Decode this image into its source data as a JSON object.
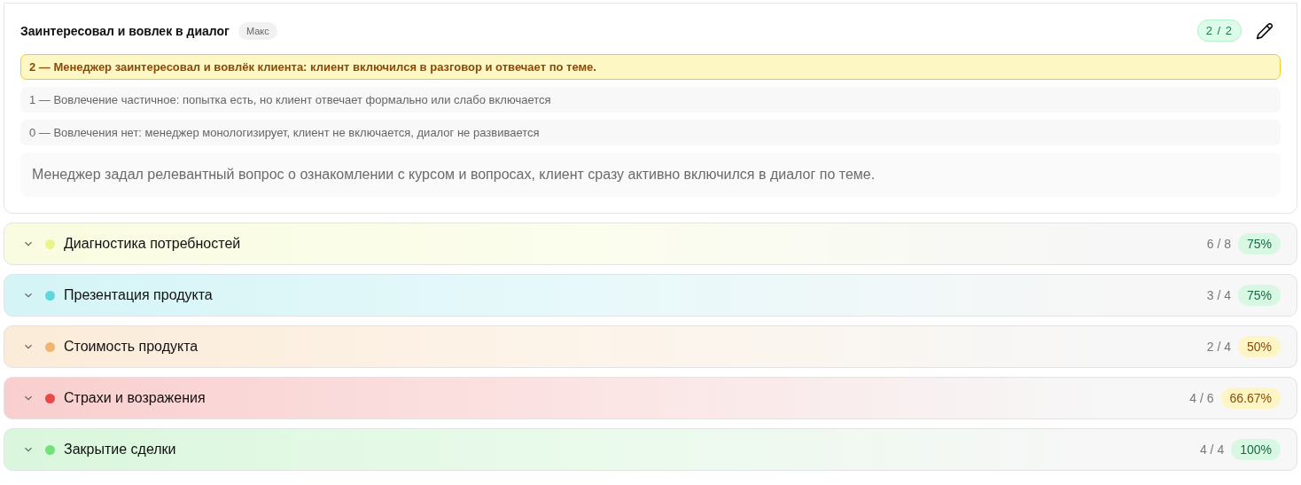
{
  "criterion": {
    "title": "Заинтересовал и вовлек в диалог",
    "tag": "Макс",
    "score": "2 / 2",
    "options": [
      {
        "text": "2 — Менеджер заинтересовал и вовлёк клиента: клиент включился в разговор и отвечает по теме.",
        "selected": true
      },
      {
        "text": "1 — Вовлечение частичное: попытка есть, но клиент отвечает формально или слабо включается",
        "selected": false
      },
      {
        "text": "0 — Вовлечения нет: менеджер монологизирует, клиент не включается, диалог не развивается",
        "selected": false
      }
    ],
    "comment": "Менеджер задал релевантный вопрос о ознакомлении с курсом и вопросах, клиент сразу активно включился в диалог по теме."
  },
  "sections": [
    {
      "title": "Диагностика потребностей",
      "color": "#e9f58a",
      "score": "6 / 8",
      "percent": "75%",
      "kind": "good",
      "expanded": false
    },
    {
      "title": "Презентация продукта",
      "color": "#5fd6de",
      "score": "3 / 4",
      "percent": "75%",
      "kind": "good",
      "expanded": false
    },
    {
      "title": "Стоимость продукта",
      "color": "#f0b570",
      "score": "2 / 4",
      "percent": "50%",
      "kind": "warn",
      "expanded": false
    },
    {
      "title": "Страхи и возражения",
      "color": "#e84848",
      "score": "4 / 6",
      "percent": "66.67%",
      "kind": "warn",
      "expanded": false
    },
    {
      "title": "Закрытие сделки",
      "color": "#72e07c",
      "score": "4 / 4",
      "percent": "100%",
      "kind": "good",
      "expanded": false
    }
  ]
}
